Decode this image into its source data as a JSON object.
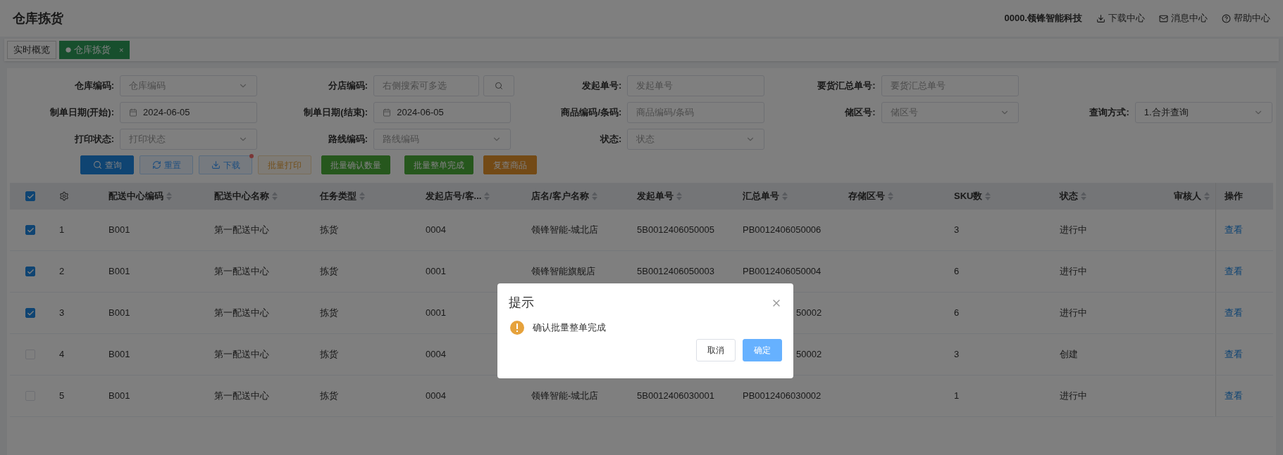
{
  "header": {
    "title": "仓库拣货",
    "company": "0000.领锋智能科技",
    "links": [
      {
        "label": "下载中心"
      },
      {
        "label": "消息中心"
      },
      {
        "label": "帮助中心"
      }
    ]
  },
  "tabs": [
    {
      "label": "实时概览",
      "selected": false,
      "closable": false
    },
    {
      "label": "仓库拣货",
      "selected": true,
      "closable": true,
      "close": "×"
    }
  ],
  "filters": [
    [
      {
        "label": "仓库编码:",
        "kind": "select",
        "placeholder": "仓库编码"
      },
      {
        "label": "分店编码:",
        "kind": "search",
        "placeholder": "右侧搜索可多选"
      },
      {
        "label": "发起单号:",
        "kind": "input",
        "placeholder": "发起单号"
      },
      {
        "label": "要货汇总单号:",
        "kind": "input",
        "placeholder": "要货汇总单号"
      }
    ],
    [
      {
        "label": "制单日期(开始):",
        "kind": "date",
        "value": "2024-06-05"
      },
      {
        "label": "制单日期(结束):",
        "kind": "date",
        "value": "2024-06-05"
      },
      {
        "label": "商品编码/条码:",
        "kind": "input",
        "placeholder": "商品编码/条码"
      },
      {
        "label": "储区号:",
        "kind": "select",
        "placeholder": "储区号"
      },
      {
        "label": "查询方式:",
        "kind": "select",
        "value": "1.合并查询"
      }
    ],
    [
      {
        "label": "打印状态:",
        "kind": "select",
        "placeholder": "打印状态"
      },
      {
        "label": "路线编码:",
        "kind": "select",
        "placeholder": "路线编码"
      },
      {
        "label": "状态:",
        "kind": "select",
        "placeholder": "状态"
      }
    ]
  ],
  "actions": [
    {
      "label": "查询",
      "kind": "primary",
      "badge": false
    },
    {
      "label": "重置",
      "kind": "plain",
      "badge": false
    },
    {
      "label": "下载",
      "kind": "plain",
      "badge": true
    },
    {
      "label": "批量打印",
      "kind": "warning-outline",
      "badge": false
    },
    {
      "label": "批量确认数量",
      "kind": "success",
      "badge": false
    },
    {
      "label": "批量整单完成",
      "kind": "success",
      "badge": false
    },
    {
      "label": "复查商品",
      "kind": "warning",
      "badge": false
    }
  ],
  "table": {
    "select_all": true,
    "columns": [
      {
        "label": "配送中心编码",
        "sortable": true
      },
      {
        "label": "配送中心名称",
        "sortable": true
      },
      {
        "label": "任务类型",
        "sortable": true
      },
      {
        "label": "发起店号/客...",
        "sortable": true
      },
      {
        "label": "店名/客户名称",
        "sortable": true
      },
      {
        "label": "发起单号",
        "sortable": true
      },
      {
        "label": "汇总单号",
        "sortable": true
      },
      {
        "label": "存储区号",
        "sortable": true
      },
      {
        "label": "SKU数",
        "sortable": true
      },
      {
        "label": "状态",
        "sortable": true
      },
      {
        "label": "审核人",
        "sortable": true
      },
      {
        "label": "操作",
        "sortable": false
      }
    ],
    "rows": [
      {
        "checked": true,
        "index": "1",
        "center_code": "B001",
        "center_name": "第一配送中心",
        "task_type": "拣货",
        "store_no": "0004",
        "store_name": "领锋智能-城北店",
        "order_no": "5B0012406050005",
        "summary_no": "PB0012406050006",
        "sku": "3",
        "status": "进行中",
        "action": "查看"
      },
      {
        "checked": true,
        "index": "2",
        "center_code": "B001",
        "center_name": "第一配送中心",
        "task_type": "拣货",
        "store_no": "0001",
        "store_name": "领锋智能旗舰店",
        "order_no": "5B0012406050003",
        "summary_no": "PB0012406050004",
        "sku": "6",
        "status": "进行中",
        "action": "查看"
      },
      {
        "checked": true,
        "index": "3",
        "center_code": "B001",
        "center_name": "第一配送中心",
        "task_type": "拣货",
        "store_no": "0001",
        "summary_tail": "50002",
        "sku": "6",
        "status": "进行中",
        "action": "查看"
      },
      {
        "checked": false,
        "index": "4",
        "center_code": "B001",
        "center_name": "第一配送中心",
        "task_type": "拣货",
        "store_no": "0004",
        "summary_tail": "50002",
        "sku": "3",
        "status": "创建",
        "action": "查看"
      },
      {
        "checked": false,
        "index": "5",
        "center_code": "B001",
        "center_name": "第一配送中心",
        "task_type": "拣货",
        "store_no": "0004",
        "store_name": "领锋智能-城北店",
        "order_no": "5B0012406030001",
        "summary_no": "PB0012406030002",
        "sku": "1",
        "status": "进行中",
        "action": "查看"
      }
    ]
  },
  "dialog": {
    "title": "提示",
    "message": "确认批量整单完成",
    "buttons": [
      {
        "label": "取消",
        "primary": false
      },
      {
        "label": "确定",
        "primary": true
      }
    ]
  }
}
